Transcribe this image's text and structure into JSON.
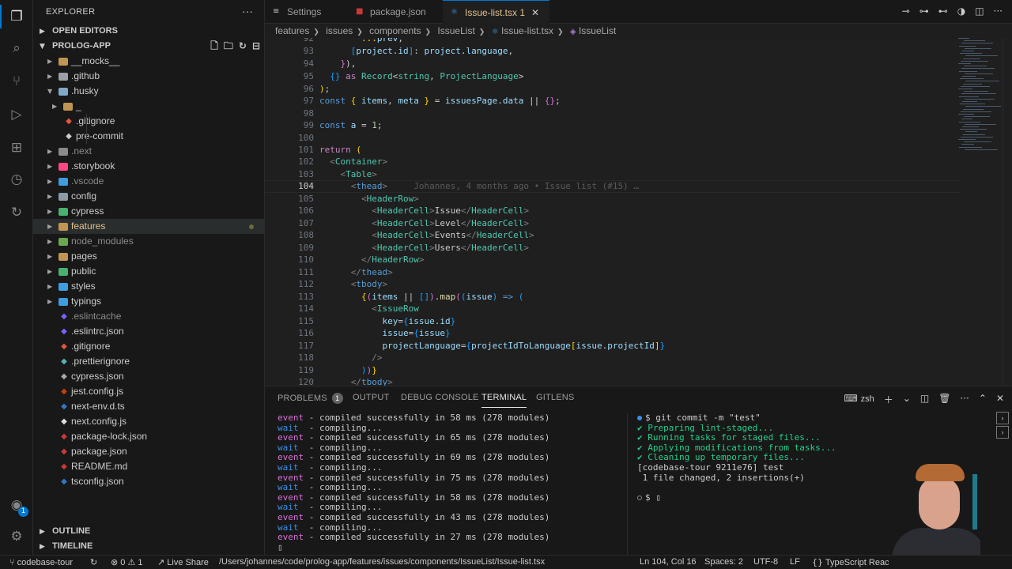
{
  "sidebar": {
    "title": "EXPLORER",
    "open_editors": "OPEN EDITORS",
    "project": "PROLOG-APP",
    "outline": "OUTLINE",
    "timeline": "TIMELINE",
    "items": [
      {
        "label": "__mocks__",
        "type": "folder",
        "color": "#c09553"
      },
      {
        "label": ".github",
        "type": "folder",
        "color": "#9aa0a6"
      },
      {
        "label": ".husky",
        "type": "folder-open",
        "color": "#7fa8c9"
      },
      {
        "label": "_",
        "type": "folder",
        "color": "#c09553"
      },
      {
        "label": ".gitignore",
        "type": "file",
        "color": "#e8553e"
      },
      {
        "label": "pre-commit",
        "type": "file",
        "color": "#cccccc"
      },
      {
        "label": ".next",
        "type": "folder",
        "color": "#8b8b8b"
      },
      {
        "label": ".storybook",
        "type": "folder",
        "color": "#ff4785"
      },
      {
        "label": ".vscode",
        "type": "folder",
        "color": "#3e9ce0"
      },
      {
        "label": "config",
        "type": "folder",
        "color": "#8a9ba8"
      },
      {
        "label": "cypress",
        "type": "folder",
        "color": "#4ab070"
      },
      {
        "label": "features",
        "type": "folder",
        "color": "#c09553"
      },
      {
        "label": "node_modules",
        "type": "folder",
        "color": "#6aa84f"
      },
      {
        "label": "pages",
        "type": "folder",
        "color": "#c09553"
      },
      {
        "label": "public",
        "type": "folder",
        "color": "#4ab070"
      },
      {
        "label": "styles",
        "type": "folder",
        "color": "#3e9ce0"
      },
      {
        "label": "typings",
        "type": "folder",
        "color": "#3e9ce0"
      },
      {
        "label": ".eslintcache",
        "type": "file",
        "color": "#7b61ff"
      },
      {
        "label": ".eslintrc.json",
        "type": "file",
        "color": "#7b61ff"
      },
      {
        "label": ".gitignore",
        "type": "file",
        "color": "#e8553e"
      },
      {
        "label": ".prettierignore",
        "type": "file",
        "color": "#56b3b4"
      },
      {
        "label": "cypress.json",
        "type": "file",
        "color": "#aaaaaa"
      },
      {
        "label": "jest.config.js",
        "type": "file",
        "color": "#c63d14"
      },
      {
        "label": "next-env.d.ts",
        "type": "file",
        "color": "#3178c6"
      },
      {
        "label": "next.config.js",
        "type": "file",
        "color": "#dddddd"
      },
      {
        "label": "package-lock.json",
        "type": "file",
        "color": "#cb3837"
      },
      {
        "label": "package.json",
        "type": "file",
        "color": "#cb3837"
      },
      {
        "label": "README.md",
        "type": "file",
        "color": "#cb3837"
      },
      {
        "label": "tsconfig.json",
        "type": "file",
        "color": "#3178c6"
      }
    ]
  },
  "tabs": [
    {
      "label": "Settings"
    },
    {
      "label": "package.json"
    },
    {
      "label": "Issue-list.tsx 1"
    }
  ],
  "breadcrumbs": [
    "features",
    "issues",
    "components",
    "IssueList",
    "Issue-list.tsx",
    "IssueList"
  ],
  "editor": {
    "line_numbers": [
      "92",
      "93",
      "94",
      "95",
      "96",
      "97",
      "98",
      "99",
      "100",
      "101",
      "102",
      "103",
      "104",
      "105",
      "106",
      "107",
      "108",
      "109",
      "110",
      "111",
      "112",
      "113",
      "114",
      "115",
      "116",
      "117",
      "118",
      "119",
      "120"
    ],
    "blame": "Johannes, 4 months ago • Issue list (#15) …"
  },
  "panel": {
    "tabs": [
      "PROBLEMS",
      "OUTPUT",
      "DEBUG CONSOLE",
      "TERMINAL",
      "GITLENS"
    ],
    "problems_count": "1",
    "shell": "zsh",
    "log": [
      {
        "kind": "event",
        "text": "event - compiled successfully in 58 ms (278 modules)"
      },
      {
        "kind": "wait",
        "text": "wait  - compiling..."
      },
      {
        "kind": "event",
        "text": "event - compiled successfully in 65 ms (278 modules)"
      },
      {
        "kind": "wait",
        "text": "wait  - compiling..."
      },
      {
        "kind": "event",
        "text": "event - compiled successfully in 69 ms (278 modules)"
      },
      {
        "kind": "wait",
        "text": "wait  - compiling..."
      },
      {
        "kind": "event",
        "text": "event - compiled successfully in 75 ms (278 modules)"
      },
      {
        "kind": "wait",
        "text": "wait  - compiling..."
      },
      {
        "kind": "event",
        "text": "event - compiled successfully in 58 ms (278 modules)"
      },
      {
        "kind": "wait",
        "text": "wait  - compiling..."
      },
      {
        "kind": "event",
        "text": "event - compiled successfully in 43 ms (278 modules)"
      },
      {
        "kind": "wait",
        "text": "wait  - compiling..."
      },
      {
        "kind": "event",
        "text": "event - compiled successfully in 27 ms (278 modules)"
      }
    ],
    "git": {
      "command": "$ git commit -m \"test\"",
      "steps": [
        "✔ Preparing lint-staged...",
        "✔ Running tasks for staged files...",
        "✔ Applying modifications from tasks...",
        "✔ Cleaning up temporary files..."
      ],
      "result1": "[codebase-tour 9211e76] test",
      "result2": " 1 file changed, 2 insertions(+)",
      "prompt": "$"
    }
  },
  "status": {
    "branch": "codebase-tour",
    "errors": "0",
    "warnings": "1",
    "live_share": "Live Share",
    "path": "/Users/johannes/code/prolog-app/features/issues/components/IssueList/Issue-list.tsx",
    "position": "Ln 104, Col 16",
    "spaces": "Spaces: 2",
    "encoding": "UTF-8",
    "eol": "LF",
    "language": "TypeScript Reac"
  },
  "activity": {
    "accounts_badge": "1"
  }
}
